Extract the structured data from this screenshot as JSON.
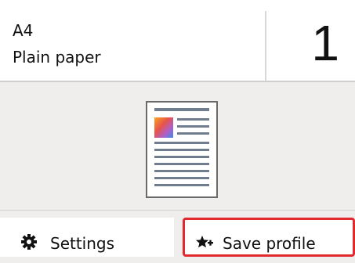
{
  "paper": {
    "size": "A4",
    "type": "Plain paper"
  },
  "copies": {
    "value": "1"
  },
  "buttons": {
    "settings_label": "Settings",
    "settings_icon": "gear-icon",
    "save_profile_label": "Save profile",
    "save_profile_icon": "star-plus-icon"
  },
  "colors": {
    "highlight_border": "#e02a2f",
    "background": "#efeeec"
  }
}
